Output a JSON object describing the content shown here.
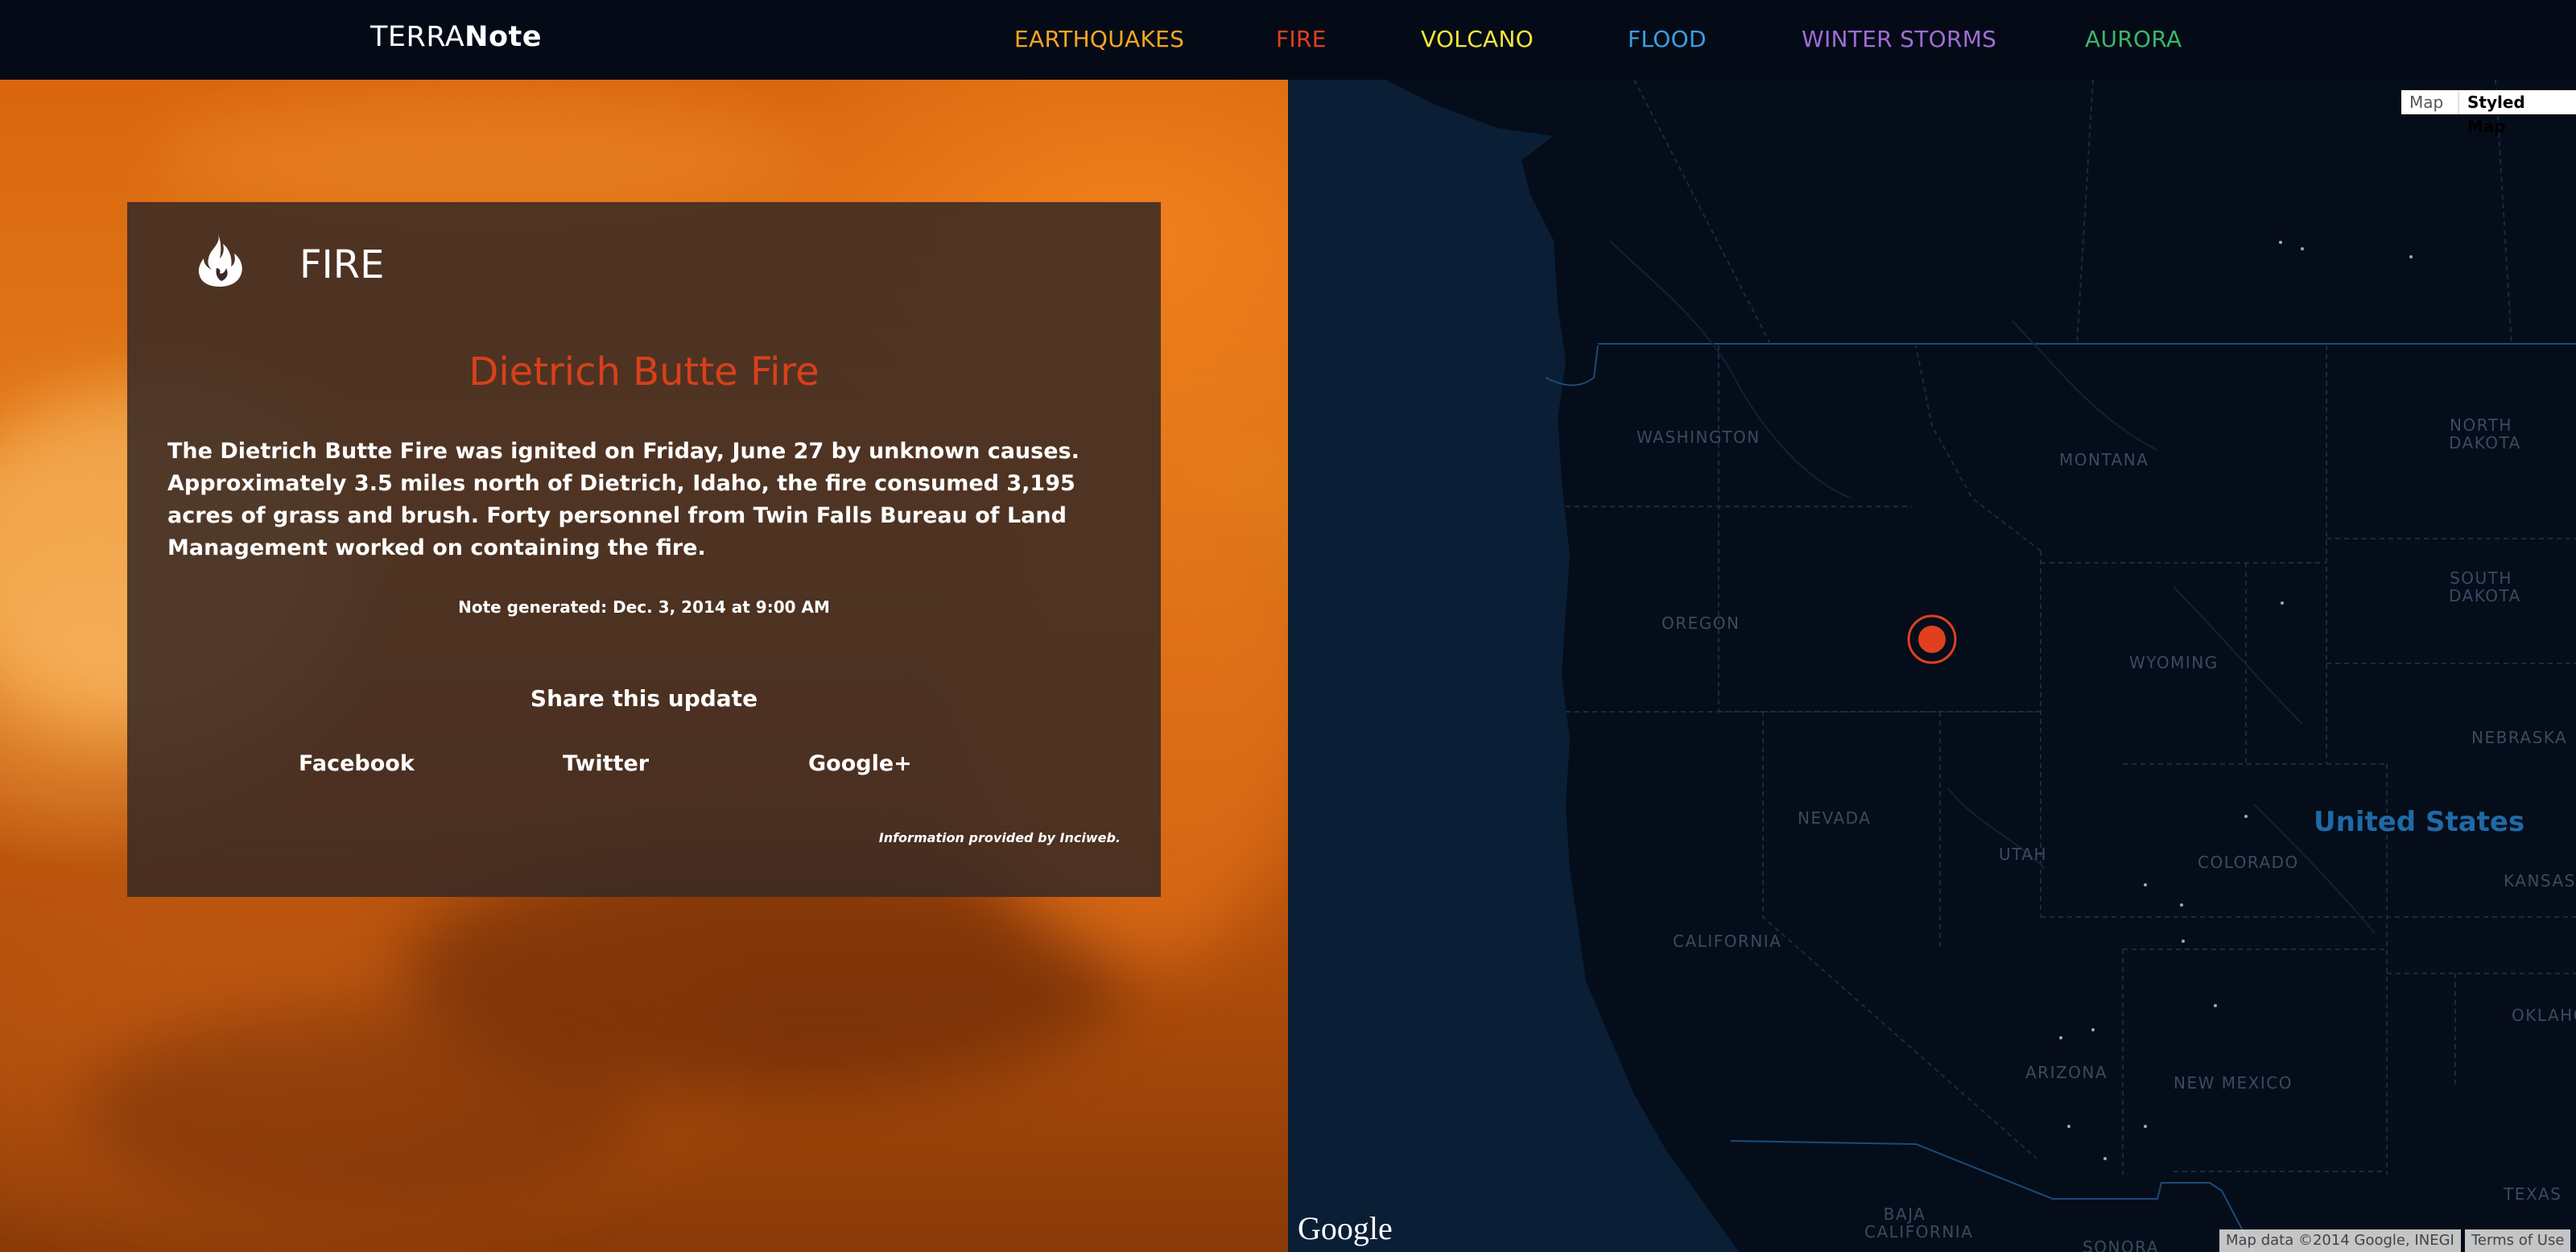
{
  "app": {
    "logo_part1": "TERRA",
    "logo_part2": "Note"
  },
  "nav": [
    {
      "label": "EARTHQUAKES",
      "color": "#f5a623"
    },
    {
      "label": "FIRE",
      "color": "#e0401e"
    },
    {
      "label": "VOLCANO",
      "color": "#f1e63c"
    },
    {
      "label": "FLOOD",
      "color": "#3d9ee0"
    },
    {
      "label": "WINTER STORMS",
      "color": "#a06cd5"
    },
    {
      "label": "AURORA",
      "color": "#3db56a"
    }
  ],
  "card": {
    "icon": "flame-icon",
    "category": "FIRE",
    "title": "Dietrich Butte Fire",
    "body": "The Dietrich Butte Fire was ignited on Friday, June 27 by unknown causes. Approximately 3.5 miles north of Dietrich, Idaho, the fire consumed 3,195 acres of grass and brush. Forty personnel from Twin Falls Bureau of Land Management worked on containing the fire.",
    "note": "Note generated: Dec. 3, 2014 at 9:00 AM",
    "share_heading": "Share this update",
    "share_links": [
      "Facebook",
      "Twitter",
      "Google+"
    ],
    "credit": "Information provided by Inciweb."
  },
  "map": {
    "buttons": [
      "Map",
      "Styled Map"
    ],
    "country_label": "United States",
    "state_labels": [
      "WASHINGTON",
      "MONTANA",
      "NORTH DAKOTA",
      "OREGON",
      "SOUTH DAKOTA",
      "WYOMING",
      "NEBRASKA",
      "NEVADA",
      "UTAH",
      "COLORADO",
      "KANSAS",
      "CALIFORNIA",
      "ARIZONA",
      "NEW MEXICO",
      "OKLAHOMA",
      "TEXAS",
      "BAJA CALIFORNIA",
      "SONORA"
    ],
    "google_logo": "Google",
    "attribution": "Map data ©2014 Google, INEGI",
    "terms": "Terms of Use",
    "marker_color": "#e0401e"
  }
}
